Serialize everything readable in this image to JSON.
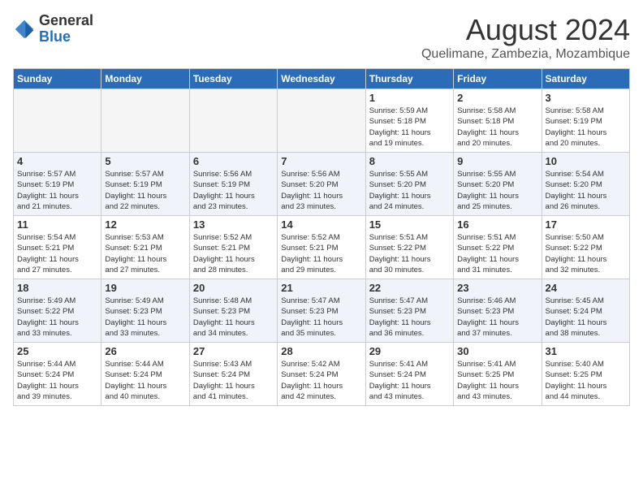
{
  "logo": {
    "general": "General",
    "blue": "Blue"
  },
  "title": "August 2024",
  "subtitle": "Quelimane, Zambezia, Mozambique",
  "headers": [
    "Sunday",
    "Monday",
    "Tuesday",
    "Wednesday",
    "Thursday",
    "Friday",
    "Saturday"
  ],
  "weeks": [
    [
      {
        "day": "",
        "info": "",
        "empty": true
      },
      {
        "day": "",
        "info": "",
        "empty": true
      },
      {
        "day": "",
        "info": "",
        "empty": true
      },
      {
        "day": "",
        "info": "",
        "empty": true
      },
      {
        "day": "1",
        "info": "Sunrise: 5:59 AM\nSunset: 5:18 PM\nDaylight: 11 hours\nand 19 minutes.",
        "empty": false
      },
      {
        "day": "2",
        "info": "Sunrise: 5:58 AM\nSunset: 5:18 PM\nDaylight: 11 hours\nand 20 minutes.",
        "empty": false
      },
      {
        "day": "3",
        "info": "Sunrise: 5:58 AM\nSunset: 5:19 PM\nDaylight: 11 hours\nand 20 minutes.",
        "empty": false
      }
    ],
    [
      {
        "day": "4",
        "info": "Sunrise: 5:57 AM\nSunset: 5:19 PM\nDaylight: 11 hours\nand 21 minutes.",
        "empty": false
      },
      {
        "day": "5",
        "info": "Sunrise: 5:57 AM\nSunset: 5:19 PM\nDaylight: 11 hours\nand 22 minutes.",
        "empty": false
      },
      {
        "day": "6",
        "info": "Sunrise: 5:56 AM\nSunset: 5:19 PM\nDaylight: 11 hours\nand 23 minutes.",
        "empty": false
      },
      {
        "day": "7",
        "info": "Sunrise: 5:56 AM\nSunset: 5:20 PM\nDaylight: 11 hours\nand 23 minutes.",
        "empty": false
      },
      {
        "day": "8",
        "info": "Sunrise: 5:55 AM\nSunset: 5:20 PM\nDaylight: 11 hours\nand 24 minutes.",
        "empty": false
      },
      {
        "day": "9",
        "info": "Sunrise: 5:55 AM\nSunset: 5:20 PM\nDaylight: 11 hours\nand 25 minutes.",
        "empty": false
      },
      {
        "day": "10",
        "info": "Sunrise: 5:54 AM\nSunset: 5:20 PM\nDaylight: 11 hours\nand 26 minutes.",
        "empty": false
      }
    ],
    [
      {
        "day": "11",
        "info": "Sunrise: 5:54 AM\nSunset: 5:21 PM\nDaylight: 11 hours\nand 27 minutes.",
        "empty": false
      },
      {
        "day": "12",
        "info": "Sunrise: 5:53 AM\nSunset: 5:21 PM\nDaylight: 11 hours\nand 27 minutes.",
        "empty": false
      },
      {
        "day": "13",
        "info": "Sunrise: 5:52 AM\nSunset: 5:21 PM\nDaylight: 11 hours\nand 28 minutes.",
        "empty": false
      },
      {
        "day": "14",
        "info": "Sunrise: 5:52 AM\nSunset: 5:21 PM\nDaylight: 11 hours\nand 29 minutes.",
        "empty": false
      },
      {
        "day": "15",
        "info": "Sunrise: 5:51 AM\nSunset: 5:22 PM\nDaylight: 11 hours\nand 30 minutes.",
        "empty": false
      },
      {
        "day": "16",
        "info": "Sunrise: 5:51 AM\nSunset: 5:22 PM\nDaylight: 11 hours\nand 31 minutes.",
        "empty": false
      },
      {
        "day": "17",
        "info": "Sunrise: 5:50 AM\nSunset: 5:22 PM\nDaylight: 11 hours\nand 32 minutes.",
        "empty": false
      }
    ],
    [
      {
        "day": "18",
        "info": "Sunrise: 5:49 AM\nSunset: 5:22 PM\nDaylight: 11 hours\nand 33 minutes.",
        "empty": false
      },
      {
        "day": "19",
        "info": "Sunrise: 5:49 AM\nSunset: 5:23 PM\nDaylight: 11 hours\nand 33 minutes.",
        "empty": false
      },
      {
        "day": "20",
        "info": "Sunrise: 5:48 AM\nSunset: 5:23 PM\nDaylight: 11 hours\nand 34 minutes.",
        "empty": false
      },
      {
        "day": "21",
        "info": "Sunrise: 5:47 AM\nSunset: 5:23 PM\nDaylight: 11 hours\nand 35 minutes.",
        "empty": false
      },
      {
        "day": "22",
        "info": "Sunrise: 5:47 AM\nSunset: 5:23 PM\nDaylight: 11 hours\nand 36 minutes.",
        "empty": false
      },
      {
        "day": "23",
        "info": "Sunrise: 5:46 AM\nSunset: 5:23 PM\nDaylight: 11 hours\nand 37 minutes.",
        "empty": false
      },
      {
        "day": "24",
        "info": "Sunrise: 5:45 AM\nSunset: 5:24 PM\nDaylight: 11 hours\nand 38 minutes.",
        "empty": false
      }
    ],
    [
      {
        "day": "25",
        "info": "Sunrise: 5:44 AM\nSunset: 5:24 PM\nDaylight: 11 hours\nand 39 minutes.",
        "empty": false
      },
      {
        "day": "26",
        "info": "Sunrise: 5:44 AM\nSunset: 5:24 PM\nDaylight: 11 hours\nand 40 minutes.",
        "empty": false
      },
      {
        "day": "27",
        "info": "Sunrise: 5:43 AM\nSunset: 5:24 PM\nDaylight: 11 hours\nand 41 minutes.",
        "empty": false
      },
      {
        "day": "28",
        "info": "Sunrise: 5:42 AM\nSunset: 5:24 PM\nDaylight: 11 hours\nand 42 minutes.",
        "empty": false
      },
      {
        "day": "29",
        "info": "Sunrise: 5:41 AM\nSunset: 5:24 PM\nDaylight: 11 hours\nand 43 minutes.",
        "empty": false
      },
      {
        "day": "30",
        "info": "Sunrise: 5:41 AM\nSunset: 5:25 PM\nDaylight: 11 hours\nand 43 minutes.",
        "empty": false
      },
      {
        "day": "31",
        "info": "Sunrise: 5:40 AM\nSunset: 5:25 PM\nDaylight: 11 hours\nand 44 minutes.",
        "empty": false
      }
    ]
  ]
}
